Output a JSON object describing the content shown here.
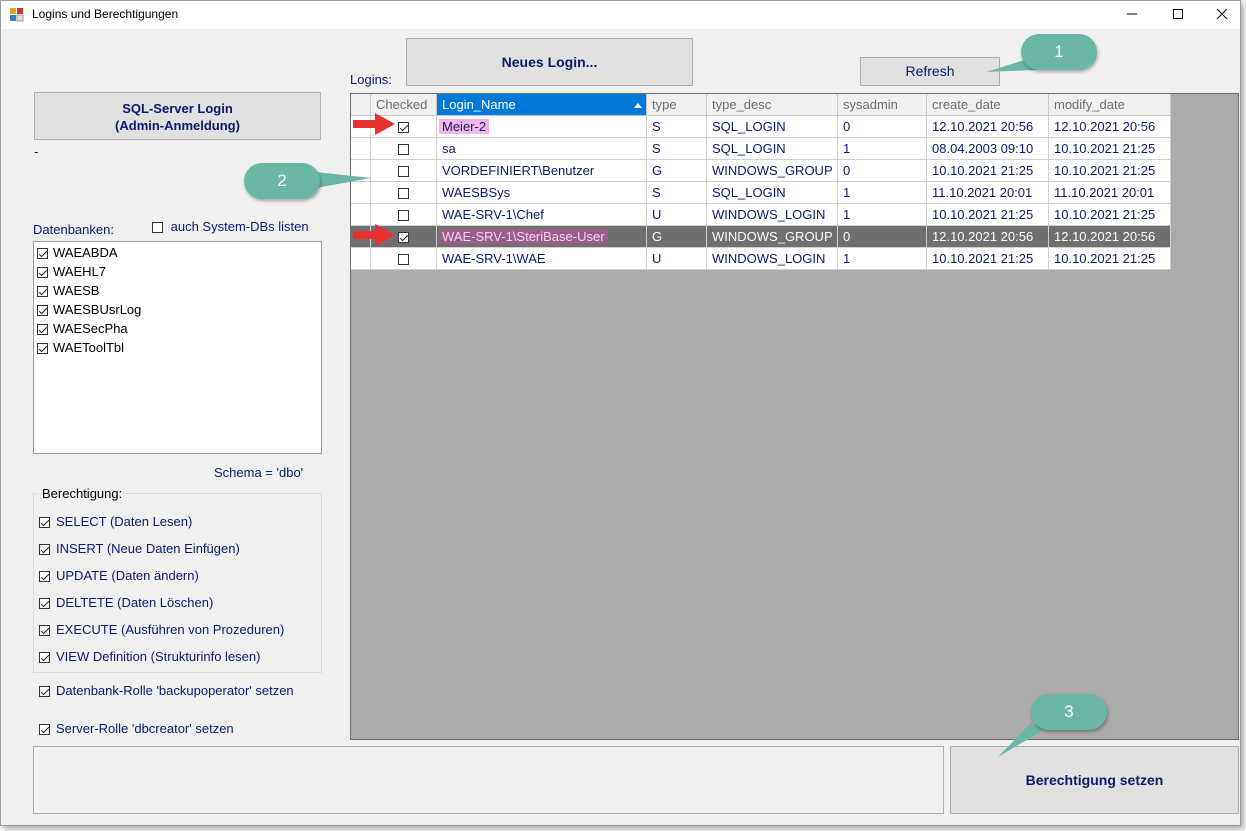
{
  "window": {
    "title": "Logins und Berechtigungen",
    "minimize": "—",
    "maximize": "☐",
    "close": "✕"
  },
  "buttons": {
    "sql_login_line1": "SQL-Server Login",
    "sql_login_line2": "(Admin-Anmeldung)",
    "new_login": "Neues Login...",
    "refresh": "Refresh",
    "set_permission": "Berechtigung setzen"
  },
  "status_dash": "-",
  "databases": {
    "label": "Datenbanken:",
    "system_dbs_label": "auch System-DBs listen",
    "system_dbs_checked": false,
    "items": [
      {
        "name": "WAEABDA",
        "checked": true
      },
      {
        "name": "WAEHL7",
        "checked": true
      },
      {
        "name": "WAESB",
        "checked": true
      },
      {
        "name": "WAESBUsrLog",
        "checked": true
      },
      {
        "name": "WAESecPha",
        "checked": true
      },
      {
        "name": "WAEToolTbl",
        "checked": true
      }
    ]
  },
  "schema_label": "Schema = 'dbo'",
  "permissions": {
    "title": "Berechtigung:",
    "items": [
      {
        "label": "SELECT (Daten Lesen)",
        "checked": true
      },
      {
        "label": "INSERT (Neue Daten Einfügen)",
        "checked": true
      },
      {
        "label": "UPDATE (Daten ändern)",
        "checked": true
      },
      {
        "label": "DELTETE (Daten Löschen)",
        "checked": true
      },
      {
        "label": "EXECUTE (Ausführen von Prozeduren)",
        "checked": true
      },
      {
        "label": "VIEW Definition (Strukturinfo lesen)",
        "checked": true
      }
    ]
  },
  "roles": {
    "backup": {
      "label": "Datenbank-Rolle 'backupoperator' setzen",
      "checked": true
    },
    "dbcreator": {
      "label": "Server-Rolle 'dbcreator' setzen",
      "checked": true
    }
  },
  "logins": {
    "label": "Logins:",
    "columns": [
      "Checked",
      "Login_Name",
      "type",
      "type_desc",
      "sysadmin",
      "create_date",
      "modify_date"
    ],
    "rows": [
      {
        "checked": true,
        "name": "Meier-2",
        "type": "S",
        "type_desc": "SQL_LOGIN",
        "sysadmin": "0",
        "create_date": "12.10.2021 20:56",
        "modify_date": "12.10.2021 20:56"
      },
      {
        "checked": false,
        "name": "sa",
        "type": "S",
        "type_desc": "SQL_LOGIN",
        "sysadmin": "1",
        "create_date": "08.04.2003 09:10",
        "modify_date": "10.10.2021 21:25"
      },
      {
        "checked": false,
        "name": "VORDEFINIERT\\Benutzer",
        "type": "G",
        "type_desc": "WINDOWS_GROUP",
        "sysadmin": "0",
        "create_date": "10.10.2021 21:25",
        "modify_date": "10.10.2021 21:25"
      },
      {
        "checked": false,
        "name": "WAESBSys",
        "type": "S",
        "type_desc": "SQL_LOGIN",
        "sysadmin": "1",
        "create_date": "11.10.2021 20:01",
        "modify_date": "11.10.2021 20:01"
      },
      {
        "checked": false,
        "name": "WAE-SRV-1\\Chef",
        "type": "U",
        "type_desc": "WINDOWS_LOGIN",
        "sysadmin": "1",
        "create_date": "10.10.2021 21:25",
        "modify_date": "10.10.2021 21:25"
      },
      {
        "checked": true,
        "name": "WAE-SRV-1\\SteriBase-User",
        "type": "G",
        "type_desc": "WINDOWS_GROUP",
        "sysadmin": "0",
        "create_date": "12.10.2021 20:56",
        "modify_date": "12.10.2021 20:56"
      },
      {
        "checked": false,
        "name": "WAE-SRV-1\\WAE",
        "type": "U",
        "type_desc": "WINDOWS_LOGIN",
        "sysadmin": "1",
        "create_date": "10.10.2021 21:25",
        "modify_date": "10.10.2021 21:25"
      }
    ]
  },
  "annotations": {
    "badge1": "1",
    "badge2": "2",
    "badge3": "3",
    "color": "#6ab7a7",
    "arrow_color": "#e8302e"
  }
}
